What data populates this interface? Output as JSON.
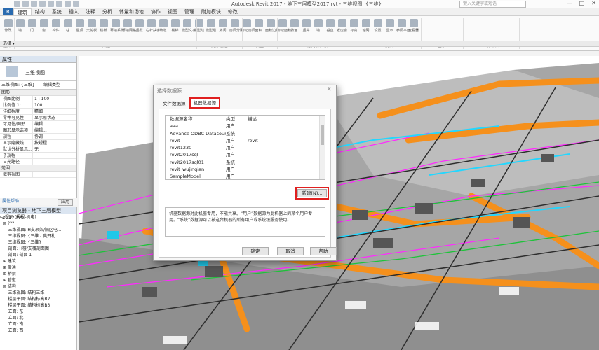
{
  "window": {
    "title": "Autodesk Revit 2017 -    地下三层模型2017.rvt - 三维视图: {三维}",
    "search_placeholder": "键入关键字或短语",
    "controls": [
      "—",
      "□",
      "✕"
    ]
  },
  "tabs": [
    "R",
    "建筑",
    "结构",
    "系统",
    "插入",
    "注释",
    "分析",
    "体量和场地",
    "协作",
    "视图",
    "管理",
    "附加模块",
    "修改"
  ],
  "ribbon_groups": [
    "选择",
    "构建",
    "楼梯坡道",
    "模型",
    "房间和面积",
    "洞口",
    "基准",
    "工作平面"
  ],
  "ribbon_buttons": [
    "修改",
    "墙",
    "门",
    "窗",
    "构件",
    "柱",
    "屋顶",
    "天花板",
    "楼板",
    "幕墙系统",
    "幕墙网格",
    "竖梃",
    "栏杆扶手",
    "坡道",
    "楼梯",
    "模型文字",
    "模型线",
    "模型组",
    "房间",
    "房间分隔",
    "标记房间",
    "面积",
    "面积边界",
    "标记面积",
    "按面",
    "竖井",
    "墙",
    "垂直",
    "老虎窗",
    "标高",
    "轴网",
    "设置",
    "显示",
    "参照平面",
    "查看器"
  ],
  "option_bar": "选择 ▾",
  "properties": {
    "title": "属性",
    "type_name": "三维视图",
    "instance": "三维视图: {三维}",
    "edit_type": "编辑类型",
    "group": "图形",
    "rows": [
      [
        "视图比例",
        "1 : 100"
      ],
      [
        "比例值 1:",
        "100"
      ],
      [
        "详细程度",
        "精细"
      ],
      [
        "零件可见性",
        "显示原状态"
      ],
      [
        "可见性/图形...",
        "编辑..."
      ],
      [
        "图形显示选项",
        "编辑..."
      ],
      [
        "规程",
        "协调"
      ],
      [
        "显示隐藏线",
        "按规程"
      ],
      [
        "默认分析显示...",
        "无"
      ],
      [
        "子规程",
        ""
      ],
      [
        "日光路径",
        ""
      ]
    ],
    "section": "范围",
    "crop": [
      "裁剪视图",
      ""
    ],
    "help": "属性帮助",
    "apply": "应用"
  },
  "browser": {
    "title": "项目浏览器 - 地下三层模型2017.rvt",
    "items": [
      "⊟ 视图 (规程-机电)",
      "  ⊟ ???",
      "      三维视图: H支吊架/隔区电...",
      "      三维视图: {三维 - 奥开礼",
      "      三维视图: {三维}",
      "      剖面: H楼/支楼剖面图",
      "      剖面: 剖面 1",
      "  ⊞ 建筑",
      "  ⊞ 暖通",
      "  ⊞ 桥架",
      "  ⊞ 管道",
      "  ⊟ 结构",
      "      三维视图: 结构三维",
      "      楼层平面: 结构标高B2",
      "      楼层平面: 结构标高B3",
      "      立面: 东",
      "      立面: 北",
      "      立面: 南",
      "      立面: 西"
    ]
  },
  "dialog": {
    "title": "选择数据源",
    "tabs": [
      "文件数据源",
      "机器数据源"
    ],
    "columns": [
      "数据源名称",
      "类型",
      "描述"
    ],
    "rows": [
      [
        "aaa",
        "用户",
        ""
      ],
      [
        "Advance ODBC Datasource",
        "系统",
        ""
      ],
      [
        "revit",
        "用户",
        "revit"
      ],
      [
        "revit1230",
        "用户",
        ""
      ],
      [
        "revit2017sql",
        "用户",
        ""
      ],
      [
        "revit2017sql01",
        "系统",
        ""
      ],
      [
        "revit_wujinqian",
        "用户",
        ""
      ],
      [
        "SampleModel",
        "用户",
        ""
      ]
    ],
    "new_button": "新建(N)...",
    "description": "机器数据源对此机器专用，不能共享。“用户”数据源为此机器上的某个用户专用。“系统”数据源可以被这台机器的所有用户或系统级服务使用。",
    "ok": "确定",
    "cancel": "取消",
    "help": "帮助"
  },
  "colors": {
    "accent": "#2a6bb0",
    "highlight": "#e02020",
    "duct": "#f5901c",
    "floor": "#9a9a9a"
  }
}
